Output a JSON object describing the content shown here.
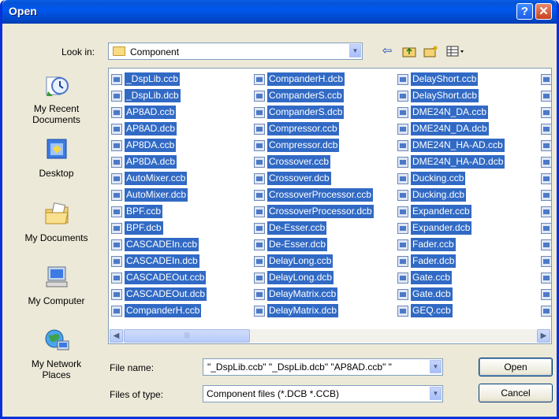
{
  "window": {
    "title": "Open",
    "help": "?",
    "close": "✕"
  },
  "lookin": {
    "label": "Look in:",
    "value": "Component"
  },
  "places": [
    {
      "label": "My Recent Documents"
    },
    {
      "label": "Desktop"
    },
    {
      "label": "My Documents"
    },
    {
      "label": "My Computer"
    },
    {
      "label": "My Network Places"
    }
  ],
  "files": {
    "col1": [
      "_DspLib.ccb",
      "_DspLib.dcb",
      "AP8AD.ccb",
      "AP8AD.dcb",
      "AP8DA.ccb",
      "AP8DA.dcb",
      "AutoMixer.ccb",
      "AutoMixer.dcb",
      "BPF.ccb",
      "BPF.dcb",
      "CASCADEIn.ccb",
      "CASCADEIn.dcb",
      "CASCADEOut.ccb",
      "CASCADEOut.dcb",
      "CompanderH.ccb"
    ],
    "col2": [
      "CompanderH.dcb",
      "CompanderS.ccb",
      "CompanderS.dcb",
      "Compressor.ccb",
      "Compressor.dcb",
      "Crossover.ccb",
      "Crossover.dcb",
      "CrossoverProcessor.ccb",
      "CrossoverProcessor.dcb",
      "De-Esser.ccb",
      "De-Esser.dcb",
      "DelayLong.ccb",
      "DelayLong.dcb",
      "DelayMatrix.ccb",
      "DelayMatrix.dcb"
    ],
    "col3": [
      "DelayShort.ccb",
      "DelayShort.dcb",
      "DME24N_DA.ccb",
      "DME24N_DA.dcb",
      "DME24N_HA-AD.ccb",
      "DME24N_HA-AD.dcb",
      "Ducking.ccb",
      "Ducking.dcb",
      "Expander.ccb",
      "Expander.dcb",
      "Fader.ccb",
      "Fader.dcb",
      "Gate.ccb",
      "Gate.dcb",
      "GEQ.ccb"
    ]
  },
  "filename": {
    "label": "File name:",
    "value": "\"_DspLib.ccb\" \"_DspLib.dcb\" \"AP8AD.ccb\" \""
  },
  "filetype": {
    "label": "Files of type:",
    "value": "Component files (*.DCB *.CCB)"
  },
  "buttons": {
    "open": "Open",
    "cancel": "Cancel"
  }
}
